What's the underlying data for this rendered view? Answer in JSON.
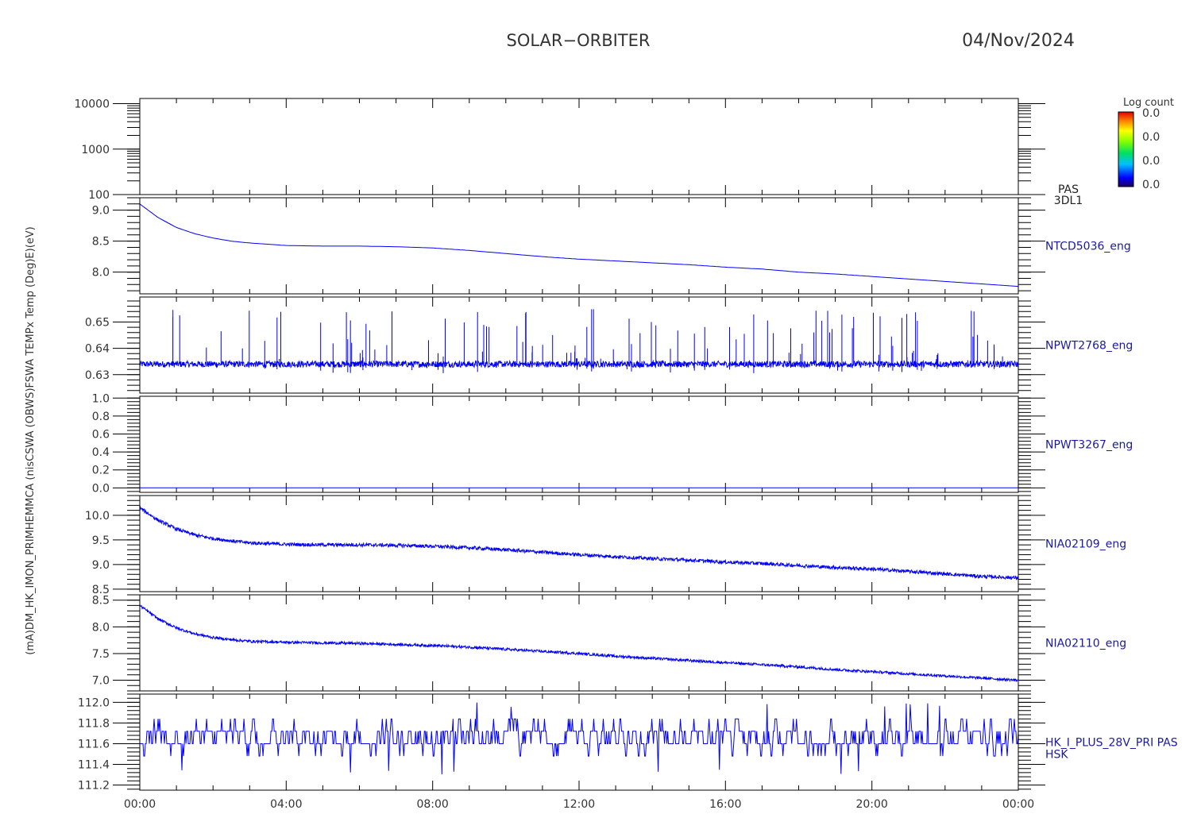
{
  "header": {
    "title": "SOLAR−ORBITER",
    "date": "04/Nov/2024"
  },
  "colorbar": {
    "title": "Log count",
    "ticks": [
      "0.0",
      "0.0",
      "0.0",
      "0.0"
    ]
  },
  "left_axis_label": "(mA)DM_HK_IMON_PRIMHEMMCA (nisCSWA (OBWS)FSWA TEMPx Temp (Deg)E)(eV)",
  "x_axis": {
    "tick_labels": [
      "00:00",
      "04:00",
      "08:00",
      "12:00",
      "16:00",
      "20:00",
      "00:00"
    ],
    "range_hours": [
      0,
      24
    ]
  },
  "colors": {
    "trace": "#0000ff",
    "axis": "#000000",
    "label": "#1a1aa0",
    "background": "#ffffff"
  },
  "chart_data": [
    {
      "type": "heatmap",
      "name": "PAS 3DL1 energy spectrogram",
      "right_label": [
        "PAS",
        "3DL1"
      ],
      "ylabel": "E (eV)",
      "yscale": "log",
      "ylim": [
        100,
        13000
      ],
      "yticks": [
        100,
        1000,
        10000
      ],
      "ytick_labels": [
        "100",
        "1000",
        "10000"
      ],
      "values": []
    },
    {
      "type": "line",
      "name": "NTCD5036_eng",
      "right_label": [
        "NTCD5036_eng"
      ],
      "ylim": [
        7.65,
        9.2
      ],
      "yticks": [
        8.0,
        8.5,
        9.0
      ],
      "ytick_labels": [
        "8.0",
        "8.5",
        "9.0"
      ],
      "noise": 0.0,
      "x_hours": [
        0,
        0.5,
        1,
        1.5,
        2,
        2.5,
        3,
        3.5,
        4,
        5,
        6,
        7,
        8,
        9,
        10,
        11,
        12,
        13,
        14,
        15,
        16,
        17,
        18,
        19,
        20,
        21,
        22,
        23,
        24
      ],
      "y": [
        9.1,
        8.88,
        8.72,
        8.62,
        8.55,
        8.5,
        8.47,
        8.45,
        8.43,
        8.42,
        8.42,
        8.41,
        8.39,
        8.35,
        8.3,
        8.25,
        8.21,
        8.18,
        8.15,
        8.12,
        8.08,
        8.05,
        8.0,
        7.97,
        7.93,
        7.89,
        7.85,
        7.81,
        7.77
      ]
    },
    {
      "type": "line",
      "name": "NPWT2768_eng",
      "right_label": [
        "NPWT2768_eng"
      ],
      "ylim": [
        0.623,
        0.6595
      ],
      "yticks": [
        0.63,
        0.64,
        0.65
      ],
      "ytick_labels": [
        "0.63",
        "0.64",
        "0.65"
      ],
      "noise": 0.0012,
      "spikes": {
        "count": 130,
        "max": 0.655,
        "min": 0.6305
      },
      "x_hours": [
        0,
        24
      ],
      "y": [
        0.634,
        0.634
      ]
    },
    {
      "type": "line",
      "name": "NPWT3267_eng",
      "right_label": [
        "NPWT3267_eng"
      ],
      "ylim": [
        -0.05,
        1.02
      ],
      "yticks": [
        0.0,
        0.2,
        0.4,
        0.6,
        0.8,
        1.0
      ],
      "ytick_labels": [
        "0.0",
        "0.2",
        "0.4",
        "0.6",
        "0.8",
        "1.0"
      ],
      "noise": 0.0,
      "x_hours": [
        0,
        24
      ],
      "y": [
        0.0,
        0.0
      ]
    },
    {
      "type": "line",
      "name": "NIA02109_eng",
      "right_label": [
        "NIA02109_eng"
      ],
      "ylim": [
        8.45,
        10.4
      ],
      "yticks": [
        8.5,
        9.0,
        9.5,
        10.0
      ],
      "ytick_labels": [
        "8.5",
        "9.0",
        "9.5",
        "10.0"
      ],
      "noise": 0.035,
      "x_hours": [
        0,
        0.5,
        1,
        1.5,
        2,
        2.5,
        3,
        4,
        5,
        6,
        7,
        8,
        9,
        10,
        11,
        12,
        13,
        14,
        15,
        16,
        17,
        18,
        19,
        20,
        21,
        22,
        23,
        24
      ],
      "y": [
        10.15,
        9.9,
        9.72,
        9.6,
        9.53,
        9.48,
        9.44,
        9.41,
        9.4,
        9.4,
        9.39,
        9.37,
        9.34,
        9.3,
        9.25,
        9.2,
        9.16,
        9.12,
        9.09,
        9.05,
        9.02,
        8.98,
        8.94,
        8.91,
        8.86,
        8.81,
        8.76,
        8.73
      ]
    },
    {
      "type": "line",
      "name": "NIA02110_eng",
      "right_label": [
        "NIA02110_eng"
      ],
      "ylim": [
        6.8,
        8.6
      ],
      "yticks": [
        7.0,
        7.5,
        8.0,
        8.5
      ],
      "ytick_labels": [
        "7.0",
        "7.5",
        "8.0",
        "8.5"
      ],
      "noise": 0.025,
      "x_hours": [
        0,
        0.5,
        1,
        1.5,
        2,
        2.5,
        3,
        4,
        5,
        6,
        7,
        8,
        9,
        10,
        11,
        12,
        13,
        14,
        15,
        16,
        17,
        18,
        19,
        20,
        21,
        22,
        23,
        24
      ],
      "y": [
        8.4,
        8.15,
        7.98,
        7.87,
        7.8,
        7.76,
        7.73,
        7.71,
        7.7,
        7.69,
        7.67,
        7.65,
        7.62,
        7.58,
        7.54,
        7.5,
        7.45,
        7.41,
        7.37,
        7.33,
        7.29,
        7.25,
        7.2,
        7.16,
        7.12,
        7.08,
        7.04,
        7.0
      ]
    },
    {
      "type": "line",
      "name": "HK_I_PLUS_28V_PRI PAS HSK",
      "right_label": [
        "HK_I_PLUS_28V_PRI PAS",
        "HSK"
      ],
      "ylim": [
        111.15,
        112.08
      ],
      "yticks": [
        111.2,
        111.4,
        111.6,
        111.8,
        112.0
      ],
      "ytick_labels": [
        "111.2",
        "111.4",
        "111.6",
        "111.8",
        "112.0"
      ],
      "levels": [
        111.48,
        111.6,
        111.72,
        111.84
      ],
      "x_hours": [
        0,
        24
      ],
      "y": [
        111.6,
        111.6
      ]
    }
  ]
}
